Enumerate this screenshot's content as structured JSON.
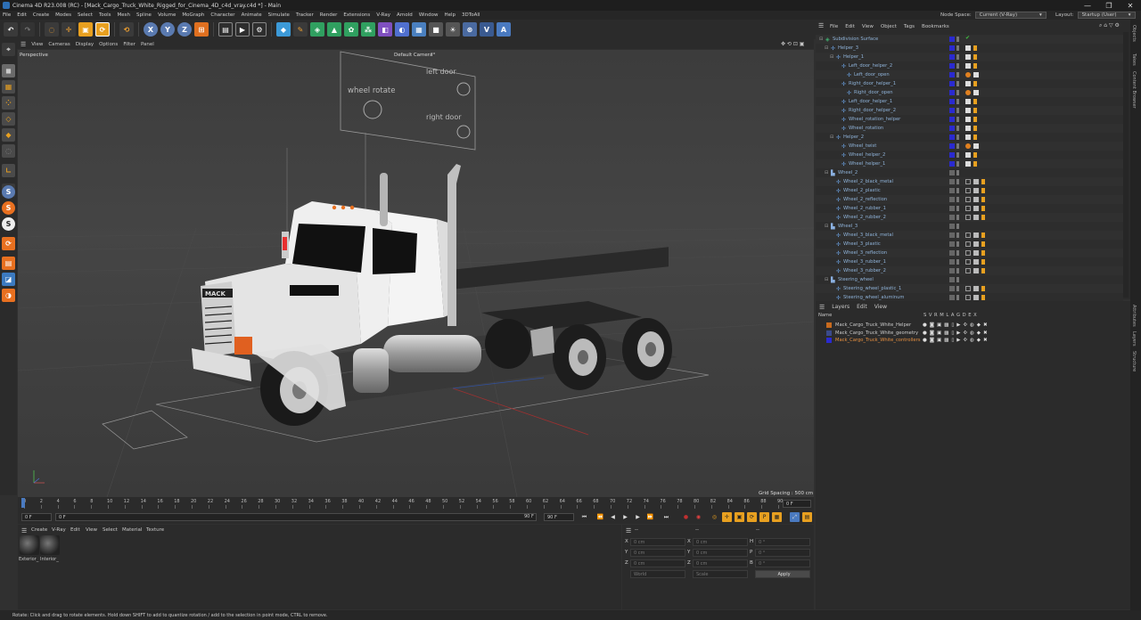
{
  "window": {
    "title": "Cinema 4D R23.008 (RC) - [Mack_Cargo_Truck_White_Rigged_for_Cinema_4D_c4d_vray.c4d *] - Main",
    "controls": [
      "—",
      "❐",
      "✕"
    ]
  },
  "menubar": {
    "items": [
      "File",
      "Edit",
      "Create",
      "Modes",
      "Select",
      "Tools",
      "Mesh",
      "Spline",
      "Volume",
      "MoGraph",
      "Character",
      "Animate",
      "Simulate",
      "Tracker",
      "Render",
      "Extensions",
      "V-Ray",
      "Arnold",
      "Window",
      "Help",
      "3DToAll"
    ],
    "node_space_label": "Node Space:",
    "node_space_value": "Current (V-Ray)",
    "layout_label": "Layout:",
    "layout_value": "Startup (User)"
  },
  "toolbar": {
    "icons": [
      "undo-icon",
      "redo-icon",
      "live-select-icon",
      "move-icon",
      "scale-icon",
      "rotate-icon",
      "recent-icon",
      "x-axis-icon",
      "y-axis-icon",
      "z-axis-icon",
      "coord-system-icon",
      "render-view-icon",
      "render-picture-viewer-icon",
      "render-settings-icon",
      "cube-icon",
      "pen-icon",
      "subdivision-icon",
      "extrude-icon",
      "cloner-icon",
      "mograph-icon",
      "deformer-icon",
      "field-icon",
      "floor-icon",
      "camera-icon",
      "light-icon",
      "python-icon",
      "vray-icon",
      "arnold-icon"
    ],
    "axis_labels": [
      "X",
      "Y",
      "Z"
    ]
  },
  "viewport": {
    "menu": [
      "View",
      "Cameras",
      "Display",
      "Options",
      "Filter",
      "Panel"
    ],
    "view_name": "Perspective",
    "camera": "Default Camera",
    "camera_suffix": "°°",
    "grid_spacing": "Grid Spacing : 500 cm",
    "controller_labels": {
      "left_door": "left door",
      "right_door": "right door",
      "wheel_rotate": "wheel rotate"
    },
    "truck_brand": "MACK"
  },
  "timeline": {
    "ticks": [
      "0",
      "2",
      "4",
      "6",
      "8",
      "10",
      "12",
      "14",
      "16",
      "18",
      "20",
      "22",
      "24",
      "26",
      "28",
      "30",
      "32",
      "34",
      "36",
      "38",
      "40",
      "42",
      "44",
      "46",
      "48",
      "50",
      "52",
      "54",
      "56",
      "58",
      "60",
      "62",
      "64",
      "66",
      "68",
      "70",
      "72",
      "74",
      "76",
      "78",
      "80",
      "82",
      "84",
      "86",
      "88",
      "90"
    ],
    "current_frame": "0 F",
    "start_field": "0 F",
    "min_field": "0 F",
    "end_field": "90 F",
    "max_field": "90 F"
  },
  "material_manager": {
    "menu": [
      "Create",
      "V-Ray",
      "Edit",
      "View",
      "Select",
      "Material",
      "Texture"
    ],
    "materials": [
      "Exterior_",
      "Interior_"
    ]
  },
  "coordinates": {
    "header_left": "--",
    "header_mid": "--",
    "header_right": "--",
    "rows": [
      {
        "a": "X",
        "av": "0 cm",
        "b": "X",
        "bv": "0 cm",
        "c": "H",
        "cv": "0 °"
      },
      {
        "a": "Y",
        "av": "0 cm",
        "b": "Y",
        "bv": "0 cm",
        "c": "P",
        "cv": "0 °"
      },
      {
        "a": "Z",
        "av": "0 cm",
        "b": "Z",
        "bv": "0 cm",
        "c": "B",
        "cv": "0 °"
      }
    ],
    "space": "World",
    "mode": "Scale",
    "apply": "Apply"
  },
  "object_manager": {
    "menu": [
      "File",
      "Edit",
      "View",
      "Object",
      "Tags",
      "Bookmarks"
    ],
    "objects": [
      {
        "name": "Subdivision Surface",
        "depth": 0,
        "icon": "subdivision",
        "tag": "check"
      },
      {
        "name": "Helper_3",
        "depth": 1,
        "icon": "null",
        "tag": "rig"
      },
      {
        "name": "Helper_1",
        "depth": 2,
        "icon": "null",
        "tag": "rig"
      },
      {
        "name": "Left_door_helper_2",
        "depth": 3,
        "icon": "null",
        "tag": "rig"
      },
      {
        "name": "Left_door_open",
        "depth": 4,
        "icon": "null",
        "tag": "xpresso"
      },
      {
        "name": "Right_door_helper_1",
        "depth": 3,
        "icon": "null",
        "tag": "rig"
      },
      {
        "name": "Right_door_open",
        "depth": 4,
        "icon": "null",
        "tag": "xpresso"
      },
      {
        "name": "Left_door_helper_1",
        "depth": 3,
        "icon": "null",
        "tag": "rig"
      },
      {
        "name": "Right_door_helper_2",
        "depth": 3,
        "icon": "null",
        "tag": "rig"
      },
      {
        "name": "Wheel_rotation_helper",
        "depth": 3,
        "icon": "null",
        "tag": "rig"
      },
      {
        "name": "Wheel_rotation",
        "depth": 3,
        "icon": "null",
        "tag": "rig"
      },
      {
        "name": "Helper_2",
        "depth": 2,
        "icon": "null",
        "tag": "rig"
      },
      {
        "name": "Wheel_twist",
        "depth": 3,
        "icon": "null",
        "tag": "xpresso"
      },
      {
        "name": "Wheel_helper_2",
        "depth": 3,
        "icon": "null",
        "tag": "rig"
      },
      {
        "name": "Wheel_helper_1",
        "depth": 3,
        "icon": "null",
        "tag": "rig"
      },
      {
        "name": "Wheel_2",
        "depth": 1,
        "icon": "group",
        "tag": "none"
      },
      {
        "name": "Wheel_2_black_metal",
        "depth": 2,
        "icon": "null",
        "tag": "mat"
      },
      {
        "name": "Wheel_2_plastic",
        "depth": 2,
        "icon": "null",
        "tag": "mat"
      },
      {
        "name": "Wheel_2_reflection",
        "depth": 2,
        "icon": "null",
        "tag": "mat"
      },
      {
        "name": "Wheel_2_rubber_1",
        "depth": 2,
        "icon": "null",
        "tag": "mat"
      },
      {
        "name": "Wheel_2_rubber_2",
        "depth": 2,
        "icon": "null",
        "tag": "mat"
      },
      {
        "name": "Wheel_3",
        "depth": 1,
        "icon": "group",
        "tag": "none"
      },
      {
        "name": "Wheel_3_black_metal",
        "depth": 2,
        "icon": "null",
        "tag": "mat"
      },
      {
        "name": "Wheel_3_plastic",
        "depth": 2,
        "icon": "null",
        "tag": "mat"
      },
      {
        "name": "Wheel_3_reflection",
        "depth": 2,
        "icon": "null",
        "tag": "mat"
      },
      {
        "name": "Wheel_3_rubber_1",
        "depth": 2,
        "icon": "null",
        "tag": "mat"
      },
      {
        "name": "Wheel_3_rubber_2",
        "depth": 2,
        "icon": "null",
        "tag": "mat"
      },
      {
        "name": "Steering_wheel",
        "depth": 1,
        "icon": "group",
        "tag": "none"
      },
      {
        "name": "Steering_wheel_plastic_1",
        "depth": 2,
        "icon": "null",
        "tag": "mat"
      },
      {
        "name": "Steering_wheel_aluminum",
        "depth": 2,
        "icon": "null",
        "tag": "mat"
      }
    ]
  },
  "layers": {
    "menu": [
      "Layers",
      "Edit",
      "View"
    ],
    "header_name": "Name",
    "header_flags": [
      "S",
      "V",
      "R",
      "M",
      "L",
      "A",
      "G",
      "D",
      "E",
      "X"
    ],
    "items": [
      {
        "name": "Mack_Cargo_Truck_White_Helper",
        "color": "#c86a1e",
        "highlight": false
      },
      {
        "name": "Mack_Cargo_Truck_White_geometry",
        "color": "#3a4a8a",
        "highlight": false
      },
      {
        "name": "Mack_Cargo_Truck_White_controllers",
        "color": "#2a2ad0",
        "highlight": true
      }
    ]
  },
  "right_tabs": [
    "Objects",
    "Takes",
    "Content Browser",
    "Attributes",
    "Layers",
    "Structure"
  ],
  "status": "Rotate: Click and drag to rotate elements. Hold down SHIFT to add to quantize rotation / add to the selection in point mode, CTRL to remove."
}
